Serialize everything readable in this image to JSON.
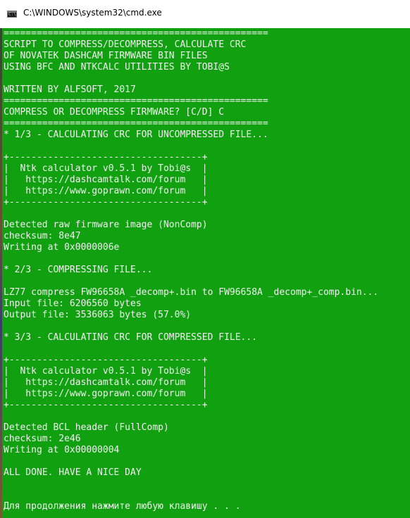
{
  "window": {
    "title": "C:\\WINDOWS\\system32\\cmd.exe",
    "icon": "cmd-icon",
    "console_bg": "#10a010",
    "console_fg": "#f2f2f2"
  },
  "console": {
    "lines": [
      "================================================",
      "SCRIPT TO COMPRESS/DECOMPRESS, CALCULATE CRC",
      "OF NOVATEK DASHCAM FIRMWARE BIN FILES",
      "USING BFC AND NTKCALC UTILITIES BY TOBI@S",
      "",
      "WRITTEN BY ALFSOFT, 2017",
      "================================================",
      "COMPRESS OR DECOMPRESS FIRMWARE? [C/D] C",
      "================================================",
      "* 1/3 - CALCULATING CRC FOR UNCOMPRESSED FILE...",
      "",
      "+-----------------------------------+",
      "|  Ntk calculator v0.5.1 by Tobi@s  |",
      "|   https://dashcamtalk.com/forum   |",
      "|   https://www.goprawn.com/forum   |",
      "+-----------------------------------+",
      "",
      "Detected raw firmware image (NonComp)",
      "checksum: 8e47",
      "Writing at 0x0000006e",
      "",
      "* 2/3 - COMPRESSING FILE...",
      "",
      "LZ77 compress FW96658A _decomp+.bin to FW96658A _decomp+_comp.bin...",
      "Input file: 6206560 bytes",
      "Output file: 3536063 bytes (57.0%)",
      "",
      "* 3/3 - CALCULATING CRC FOR COMPRESSED FILE...",
      "",
      "+-----------------------------------+",
      "|  Ntk calculator v0.5.1 by Tobi@s  |",
      "|   https://dashcamtalk.com/forum   |",
      "|   https://www.goprawn.com/forum   |",
      "+-----------------------------------+",
      "",
      "Detected BCL header (FullComp)",
      "checksum: 2e46",
      "Writing at 0x00000004",
      "",
      "ALL DONE. HAVE A NICE DAY",
      "",
      "",
      "Для продолжения нажмите любую клавишу . . ."
    ]
  }
}
